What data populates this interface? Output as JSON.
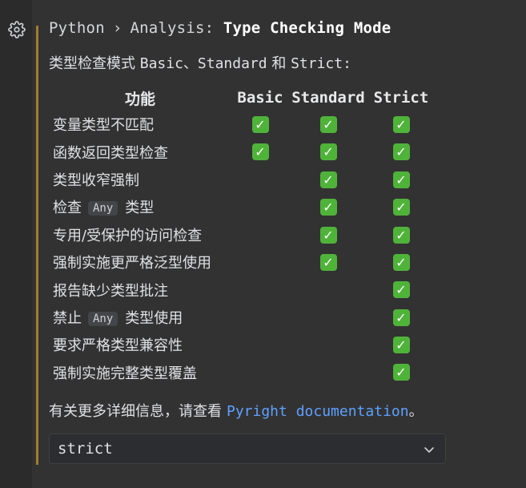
{
  "breadcrumb": {
    "root": "Python",
    "separator": "›",
    "middle": "Analysis:",
    "leaf": "Type Checking Mode"
  },
  "description": {
    "prefix": "类型检查模式 ",
    "modes": "Basic、Standard",
    "and": " 和 ",
    "last": "Strict",
    "colon": ":"
  },
  "table": {
    "headers": {
      "feature": "功能",
      "basic": "Basic",
      "standard": "Standard",
      "strict": "Strict"
    },
    "check_glyph": "✓",
    "rows": [
      {
        "pre": "变量类型不匹配",
        "code": "",
        "post": "",
        "basic": true,
        "standard": true,
        "strict": true
      },
      {
        "pre": "函数返回类型检查",
        "code": "",
        "post": "",
        "basic": true,
        "standard": true,
        "strict": true
      },
      {
        "pre": "类型收窄强制",
        "code": "",
        "post": "",
        "basic": false,
        "standard": true,
        "strict": true
      },
      {
        "pre": "检查",
        "code": "Any",
        "post": "类型",
        "basic": false,
        "standard": true,
        "strict": true
      },
      {
        "pre": "专用/受保护的访问检查",
        "code": "",
        "post": "",
        "basic": false,
        "standard": true,
        "strict": true
      },
      {
        "pre": "强制实施更严格泛型使用",
        "code": "",
        "post": "",
        "basic": false,
        "standard": true,
        "strict": true
      },
      {
        "pre": "报告缺少类型批注",
        "code": "",
        "post": "",
        "basic": false,
        "standard": false,
        "strict": true
      },
      {
        "pre": "禁止",
        "code": "Any",
        "post": "类型使用",
        "basic": false,
        "standard": false,
        "strict": true
      },
      {
        "pre": "要求严格类型兼容性",
        "code": "",
        "post": "",
        "basic": false,
        "standard": false,
        "strict": true
      },
      {
        "pre": "强制实施完整类型覆盖",
        "code": "",
        "post": "",
        "basic": false,
        "standard": false,
        "strict": true
      }
    ]
  },
  "footer": {
    "text": "有关更多详细信息，请查看",
    "link": "Pyright documentation",
    "end": "。"
  },
  "select": {
    "value": "strict"
  },
  "colors": {
    "accent_bar": "#a07e2e",
    "link": "#5ea1ff",
    "check_bg": "#4fb33a"
  },
  "icons": {
    "gutter": "gear-icon",
    "select": "chevron-down-icon",
    "check": "check-mark-icon"
  }
}
